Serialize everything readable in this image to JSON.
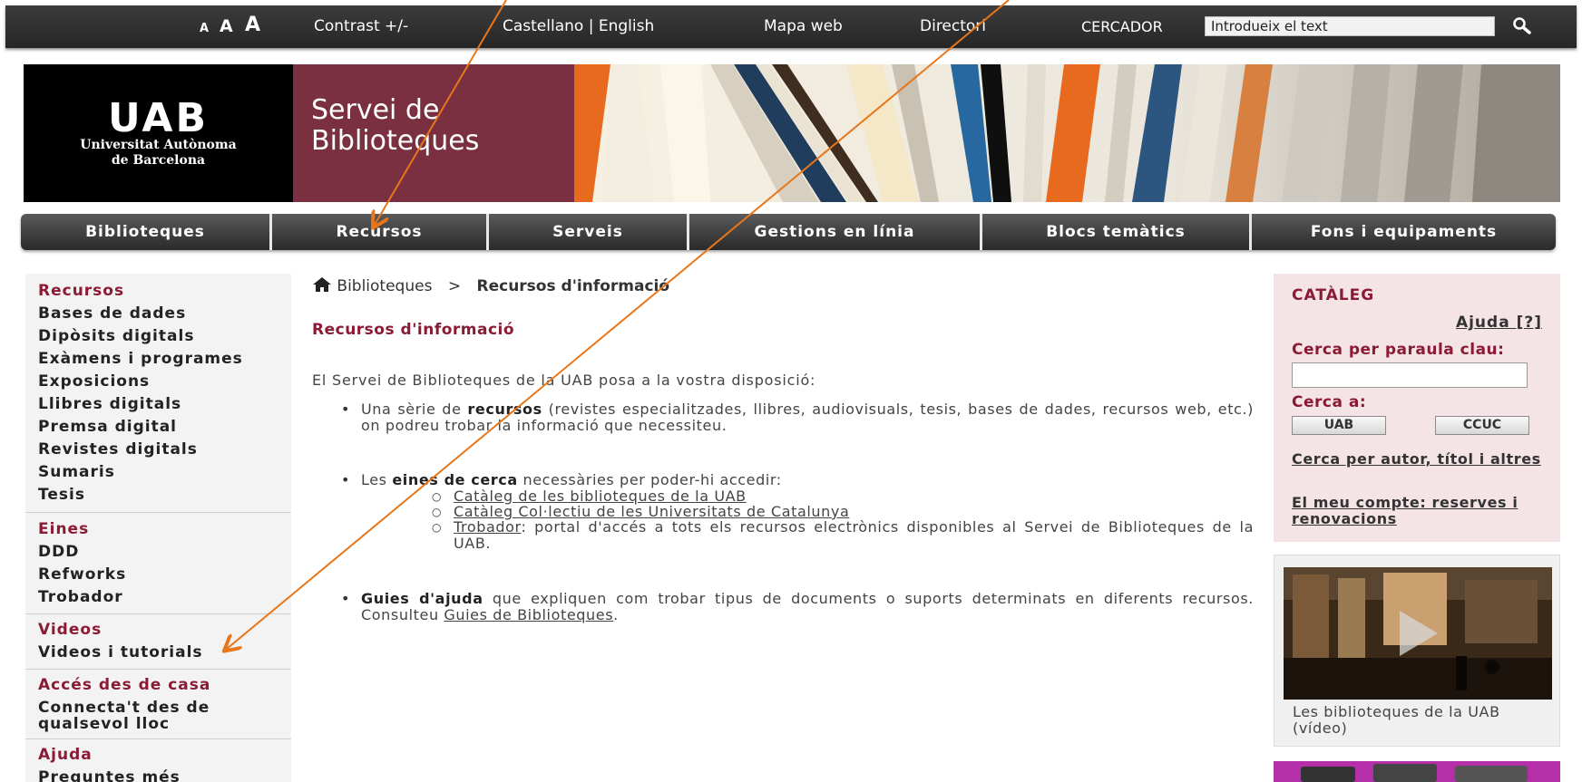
{
  "topbar": {
    "font_a_small": "A",
    "font_a_medium": "A",
    "font_a_large": "A",
    "contrast": "Contrast +/-",
    "language": "Castellano | English",
    "sitemap": "Mapa web",
    "directory": "Directori",
    "search_label": "CERCADOR",
    "search_value": "Introdueix el text",
    "search_icon": "magnifier-icon"
  },
  "banner": {
    "logo_mark": "UAB",
    "logo_line1": "Universitat Autònoma",
    "logo_line2": "de Barcelona",
    "site_title": "Servei de Biblioteques",
    "title_bg": "#7a3040"
  },
  "nav": {
    "items": [
      "Biblioteques",
      "Recursos",
      "Serveis",
      "Gestions en línia",
      "Blocs temàtics",
      "Fons i equipaments"
    ]
  },
  "sidebar": {
    "recursos_head": "Recursos",
    "recursos_items": [
      "Bases de dades",
      "Dipòsits digitals",
      "Exàmens i programes",
      "Exposicions",
      "Llibres digitals",
      "Premsa digital",
      "Revistes digitals",
      "Sumaris",
      "Tesis"
    ],
    "eines_head": "Eines",
    "eines_items": [
      "DDD",
      "Refworks",
      "Trobador"
    ],
    "videos_head": "Videos",
    "videos_items": [
      "Videos i tutorials"
    ],
    "acces_head": "Accés des de casa",
    "acces_line1": "Connecta't des de",
    "acces_line2": "qualsevol lloc",
    "ajuda_head": "Ajuda",
    "ajuda_item": "Preguntes més"
  },
  "main": {
    "breadcrumb_home": "Biblioteques",
    "breadcrumb_sep": ">",
    "breadcrumb_current": "Recursos d'informació",
    "heading": "Recursos d'informació",
    "intro": "El Servei de Biblioteques de la UAB posa a la vostra disposició:",
    "b1_pre": "Una sèrie de ",
    "b1_bold": "recursos",
    "b1_post": " (revistes especialitzades, llibres, audiovisuals, tesis, bases de dades, recursos web, etc.) on podreu trobar la informació que necessiteu.",
    "b2_pre": "Les ",
    "b2_bold": "eines de cerca",
    "b2_post": " necessàries per poder-hi accedir:",
    "sub1": "Catàleg de les biblioteques de la UAB",
    "sub2": "Catàleg Col·lectiu de les Universitats de Catalunya",
    "sub3_link": "Trobador",
    "sub3_text": ":  portal d'accés a tots els recursos electrònics disponibles al Servei de Biblioteques de la UAB.",
    "b3_bold": "Guies d'ajuda",
    "b3_post": " que expliquen com trobar tipus de documents o suports determinats en diferents recursos. Consulteu ",
    "b3_link": "Guies de Biblioteques",
    "b3_end": "."
  },
  "catalog": {
    "title": "CATÀLEG",
    "help": "Ajuda [?]",
    "keyword_label": "Cerca per paraula clau:",
    "search_in_label": "Cerca a:",
    "btn_uab": "UAB",
    "btn_ccuc": "CCUC",
    "link_author": "Cerca per autor, títol i altres",
    "link_account": "El meu compte: reserves i renovacions"
  },
  "video": {
    "caption": "Les biblioteques de la UAB (vídeo)"
  },
  "colors": {
    "accent": "#8b1a35",
    "annotation_arrow": "#e8761a",
    "catalog_bg": "#f4e4e6"
  }
}
